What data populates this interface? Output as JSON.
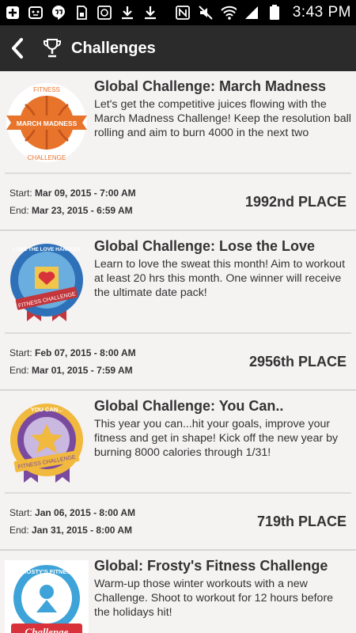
{
  "status_bar": {
    "time": "3:43 PM",
    "left_icons": [
      "plus-box-icon",
      "robot-icon",
      "hangouts-icon",
      "sd-card-icon",
      "gallery-icon",
      "download-icon",
      "download-icon"
    ],
    "right_icons": [
      "nfc-icon",
      "mute-icon",
      "wifi-icon",
      "signal-icon",
      "battery-icon"
    ]
  },
  "header": {
    "title": "Challenges",
    "back_icon": "back-arrow-icon",
    "title_icon": "trophy-icon"
  },
  "labels": {
    "start": "Start:",
    "end": "End:"
  },
  "challenges": [
    {
      "title": "Global Challenge: March Madness",
      "description": "Let's get the competitive juices flowing with the March Madness Challenge! Keep the resolution ball rolling and aim to burn 4000 in the next two",
      "start": "Mar 09, 2015 - 7:00 AM",
      "end": "Mar 23, 2015 - 6:59 AM",
      "place": "1992nd PLACE",
      "badge": {
        "top_text": "FITNESS",
        "banner": "MARCH MADNESS",
        "bottom_text": "CHALLENGE"
      }
    },
    {
      "title": "Global Challenge: Lose the Love",
      "description": "Learn to love the sweat this month! Aim to workout at least 20 hrs this month. One winner will receive the ultimate date pack!",
      "start": "Feb 07, 2015 - 8:00 AM",
      "end": "Mar 01, 2015 - 7:59 AM",
      "place": "2956th PLACE",
      "badge": {
        "top_text": "LOSE THE LOVE HANDLES",
        "banner": "FITNESS CHALLENGE"
      }
    },
    {
      "title": "Global Challenge: You Can..",
      "description": "This year you can...hit your goals, improve your fitness and get in shape! Kick off the new year by burning 8000 calories through 1/31!",
      "start": "Jan 06, 2015 - 8:00 AM",
      "end": "Jan 31, 2015 - 8:00 AM",
      "place": "719th PLACE",
      "badge": {
        "top_text": "YOU CAN...",
        "banner": "FITNESS CHALLENGE"
      }
    },
    {
      "title": "Global: Frosty's Fitness Challenge",
      "description": "Warm-up those winter workouts with a new Challenge. Shoot to workout for 12 hours before the holidays hit!",
      "badge": {
        "top_text": "FROSTY'S FITNESS",
        "banner": "Challenge"
      }
    }
  ]
}
